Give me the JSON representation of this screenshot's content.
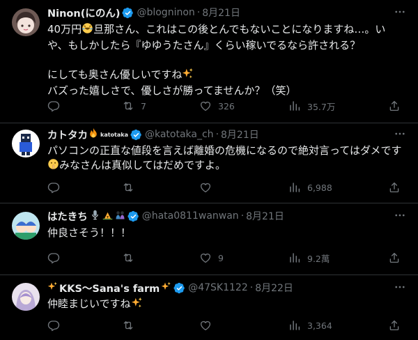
{
  "tweets": [
    {
      "name": "Ninon(にのん)",
      "handle": "@blogninon",
      "date": "8月21日",
      "lines": [
        "40万円",
        "旦那さん、これはこの後とんでもないことになりますね…。い",
        "や、もしかしたら『ゆゆうたさん』くらい稼いでるなら許される？",
        "にしても奥さん優しいですね",
        "バズった嬉しさで、優しさが勝ってませんか？（笑）"
      ],
      "reply_count": "",
      "retweet_count": "7",
      "like_count": "326",
      "view_count": "35.7万"
    },
    {
      "name": "カトタカ",
      "name_sticker": "katotaka",
      "handle": "@katotaka_ch",
      "date": "8月21日",
      "lines": [
        "パソコンの正直な値段を言えば離婚の危機になるので絶対言ってはダメです",
        "みなさんは真似してはだめですよ。"
      ],
      "reply_count": "",
      "retweet_count": "",
      "like_count": "",
      "view_count": "6,988"
    },
    {
      "name": "はたきち",
      "handle": "@hata0811wanwan",
      "date": "8月21日",
      "lines": [
        "仲良さそう！！！"
      ],
      "reply_count": "",
      "retweet_count": "",
      "like_count": "9",
      "view_count": "9.2萬"
    },
    {
      "name": "KKS～Sana's farm",
      "handle": "@47SK1122",
      "date": "8月22日",
      "lines": [
        "仲睦まじいですね"
      ],
      "reply_count": "",
      "retweet_count": "",
      "like_count": "",
      "view_count": "3,364"
    }
  ],
  "colors": {
    "background": "#000000",
    "text": "#e7e9ea",
    "muted": "#71767b",
    "border": "#2f3336",
    "verified": "#1d9bf0"
  },
  "icons": [
    "reply-icon",
    "retweet-icon",
    "like-icon",
    "views-icon",
    "share-icon",
    "verified-badge-icon",
    "more-icon"
  ]
}
